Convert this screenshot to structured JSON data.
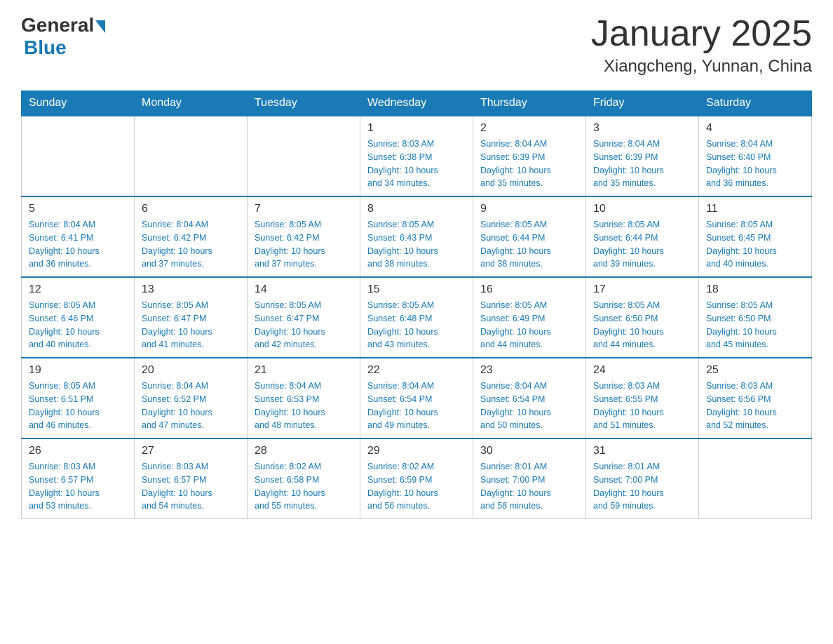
{
  "header": {
    "logo_general": "General",
    "logo_blue": "Blue",
    "title": "January 2025",
    "subtitle": "Xiangcheng, Yunnan, China"
  },
  "days_of_week": [
    "Sunday",
    "Monday",
    "Tuesday",
    "Wednesday",
    "Thursday",
    "Friday",
    "Saturday"
  ],
  "weeks": [
    [
      {
        "day": "",
        "info": ""
      },
      {
        "day": "",
        "info": ""
      },
      {
        "day": "",
        "info": ""
      },
      {
        "day": "1",
        "info": "Sunrise: 8:03 AM\nSunset: 6:38 PM\nDaylight: 10 hours\nand 34 minutes."
      },
      {
        "day": "2",
        "info": "Sunrise: 8:04 AM\nSunset: 6:39 PM\nDaylight: 10 hours\nand 35 minutes."
      },
      {
        "day": "3",
        "info": "Sunrise: 8:04 AM\nSunset: 6:39 PM\nDaylight: 10 hours\nand 35 minutes."
      },
      {
        "day": "4",
        "info": "Sunrise: 8:04 AM\nSunset: 6:40 PM\nDaylight: 10 hours\nand 36 minutes."
      }
    ],
    [
      {
        "day": "5",
        "info": "Sunrise: 8:04 AM\nSunset: 6:41 PM\nDaylight: 10 hours\nand 36 minutes."
      },
      {
        "day": "6",
        "info": "Sunrise: 8:04 AM\nSunset: 6:42 PM\nDaylight: 10 hours\nand 37 minutes."
      },
      {
        "day": "7",
        "info": "Sunrise: 8:05 AM\nSunset: 6:42 PM\nDaylight: 10 hours\nand 37 minutes."
      },
      {
        "day": "8",
        "info": "Sunrise: 8:05 AM\nSunset: 6:43 PM\nDaylight: 10 hours\nand 38 minutes."
      },
      {
        "day": "9",
        "info": "Sunrise: 8:05 AM\nSunset: 6:44 PM\nDaylight: 10 hours\nand 38 minutes."
      },
      {
        "day": "10",
        "info": "Sunrise: 8:05 AM\nSunset: 6:44 PM\nDaylight: 10 hours\nand 39 minutes."
      },
      {
        "day": "11",
        "info": "Sunrise: 8:05 AM\nSunset: 6:45 PM\nDaylight: 10 hours\nand 40 minutes."
      }
    ],
    [
      {
        "day": "12",
        "info": "Sunrise: 8:05 AM\nSunset: 6:46 PM\nDaylight: 10 hours\nand 40 minutes."
      },
      {
        "day": "13",
        "info": "Sunrise: 8:05 AM\nSunset: 6:47 PM\nDaylight: 10 hours\nand 41 minutes."
      },
      {
        "day": "14",
        "info": "Sunrise: 8:05 AM\nSunset: 6:47 PM\nDaylight: 10 hours\nand 42 minutes."
      },
      {
        "day": "15",
        "info": "Sunrise: 8:05 AM\nSunset: 6:48 PM\nDaylight: 10 hours\nand 43 minutes."
      },
      {
        "day": "16",
        "info": "Sunrise: 8:05 AM\nSunset: 6:49 PM\nDaylight: 10 hours\nand 44 minutes."
      },
      {
        "day": "17",
        "info": "Sunrise: 8:05 AM\nSunset: 6:50 PM\nDaylight: 10 hours\nand 44 minutes."
      },
      {
        "day": "18",
        "info": "Sunrise: 8:05 AM\nSunset: 6:50 PM\nDaylight: 10 hours\nand 45 minutes."
      }
    ],
    [
      {
        "day": "19",
        "info": "Sunrise: 8:05 AM\nSunset: 6:51 PM\nDaylight: 10 hours\nand 46 minutes."
      },
      {
        "day": "20",
        "info": "Sunrise: 8:04 AM\nSunset: 6:52 PM\nDaylight: 10 hours\nand 47 minutes."
      },
      {
        "day": "21",
        "info": "Sunrise: 8:04 AM\nSunset: 6:53 PM\nDaylight: 10 hours\nand 48 minutes."
      },
      {
        "day": "22",
        "info": "Sunrise: 8:04 AM\nSunset: 6:54 PM\nDaylight: 10 hours\nand 49 minutes."
      },
      {
        "day": "23",
        "info": "Sunrise: 8:04 AM\nSunset: 6:54 PM\nDaylight: 10 hours\nand 50 minutes."
      },
      {
        "day": "24",
        "info": "Sunrise: 8:03 AM\nSunset: 6:55 PM\nDaylight: 10 hours\nand 51 minutes."
      },
      {
        "day": "25",
        "info": "Sunrise: 8:03 AM\nSunset: 6:56 PM\nDaylight: 10 hours\nand 52 minutes."
      }
    ],
    [
      {
        "day": "26",
        "info": "Sunrise: 8:03 AM\nSunset: 6:57 PM\nDaylight: 10 hours\nand 53 minutes."
      },
      {
        "day": "27",
        "info": "Sunrise: 8:03 AM\nSunset: 6:57 PM\nDaylight: 10 hours\nand 54 minutes."
      },
      {
        "day": "28",
        "info": "Sunrise: 8:02 AM\nSunset: 6:58 PM\nDaylight: 10 hours\nand 55 minutes."
      },
      {
        "day": "29",
        "info": "Sunrise: 8:02 AM\nSunset: 6:59 PM\nDaylight: 10 hours\nand 56 minutes."
      },
      {
        "day": "30",
        "info": "Sunrise: 8:01 AM\nSunset: 7:00 PM\nDaylight: 10 hours\nand 58 minutes."
      },
      {
        "day": "31",
        "info": "Sunrise: 8:01 AM\nSunset: 7:00 PM\nDaylight: 10 hours\nand 59 minutes."
      },
      {
        "day": "",
        "info": ""
      }
    ]
  ]
}
